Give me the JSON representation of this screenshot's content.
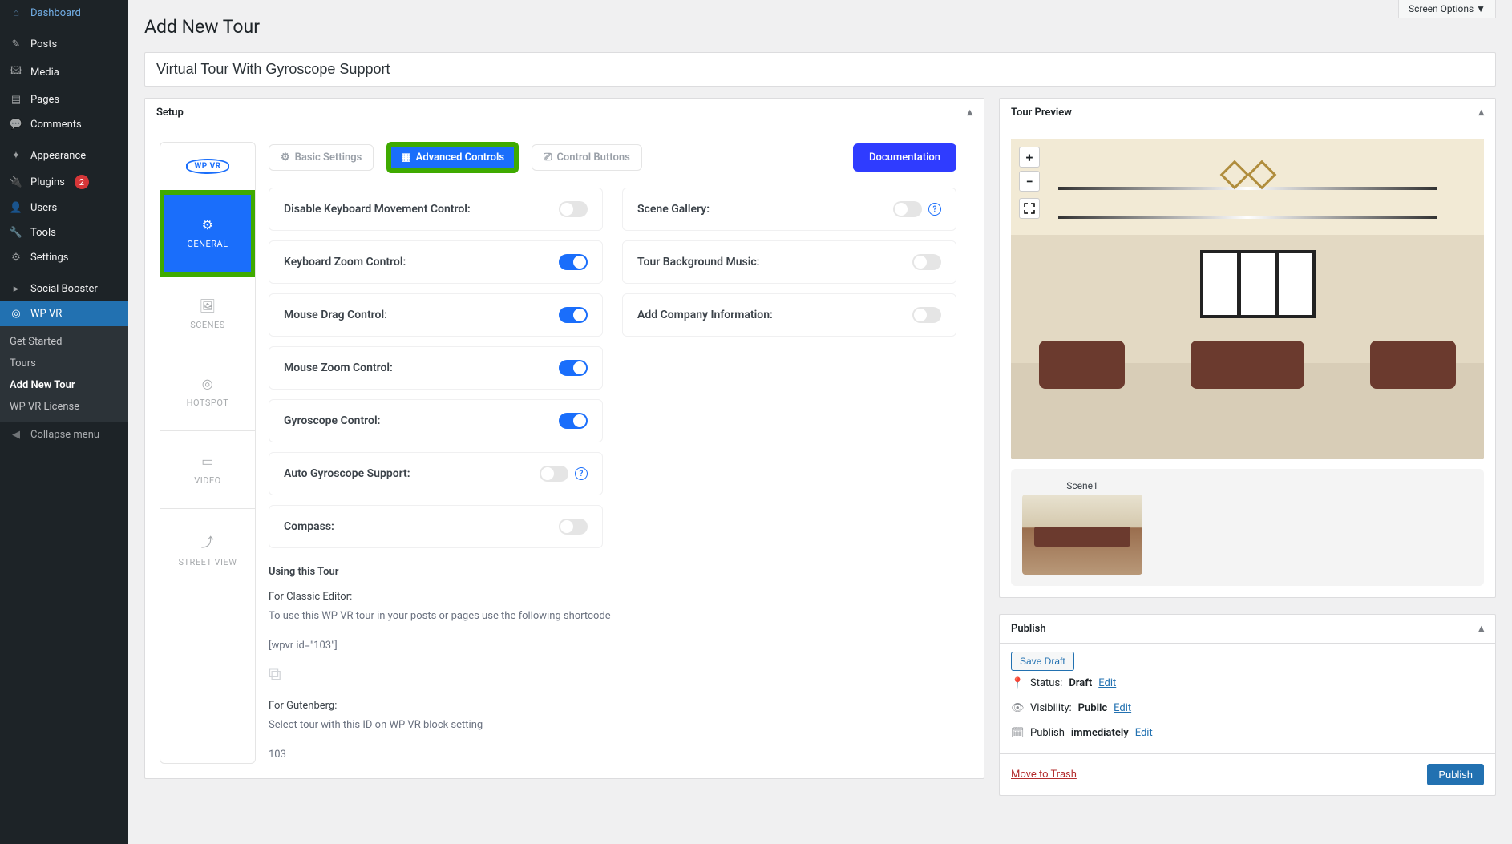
{
  "screen_options": "Screen Options ▼",
  "page_heading": "Add New Tour",
  "title_value": "Virtual Tour With Gyroscope Support",
  "sidebar": {
    "items": [
      {
        "icon": "⌂",
        "label": "Dashboard"
      },
      {
        "icon": "✎",
        "label": "Posts"
      },
      {
        "icon": "🖾",
        "label": "Media"
      },
      {
        "icon": "▤",
        "label": "Pages"
      },
      {
        "icon": "💬",
        "label": "Comments"
      },
      {
        "icon": "✦",
        "label": "Appearance"
      },
      {
        "icon": "🔌",
        "label": "Plugins",
        "badge": "2"
      },
      {
        "icon": "👤",
        "label": "Users"
      },
      {
        "icon": "🔧",
        "label": "Tools"
      },
      {
        "icon": "⚙",
        "label": "Settings"
      },
      {
        "icon": "▸",
        "label": "Social Booster"
      },
      {
        "icon": "◎",
        "label": "WP VR",
        "active": true
      }
    ],
    "submenu": [
      "Get Started",
      "Tours",
      "Add New Tour",
      "WP VR License"
    ],
    "collapse": "Collapse menu"
  },
  "setup": {
    "header": "Setup",
    "vtabs": {
      "logo": "WP VR",
      "general": "GENERAL",
      "scenes": "SCENES",
      "hotspot": "HOTSPOT",
      "video": "VIDEO",
      "street": "STREET VIEW"
    },
    "topTabs": {
      "basic": "Basic Settings",
      "advanced": "Advanced Controls",
      "control_btns": "Control Buttons"
    },
    "doc_btn": "Documentation",
    "controls": {
      "disable_kb": "Disable Keyboard Movement Control:",
      "kb_zoom": "Keyboard Zoom Control:",
      "mouse_drag": "Mouse Drag Control:",
      "mouse_zoom": "Mouse Zoom Control:",
      "gyro": "Gyroscope Control:",
      "auto_gyro": "Auto Gyroscope Support:",
      "compass": "Compass:",
      "scene_gallery": "Scene Gallery:",
      "bg_music": "Tour Background Music:",
      "company": "Add Company Information:"
    },
    "usage": {
      "heading": "Using this Tour",
      "classic_title": "For Classic Editor:",
      "classic_text": "To use this WP VR tour in your posts or pages use the following shortcode",
      "shortcode": "[wpvr id=\"103\"]",
      "gutenberg_title": "For Gutenberg:",
      "gutenberg_text": "Select tour with this ID on WP VR block setting",
      "id": "103"
    }
  },
  "preview": {
    "header": "Tour Preview",
    "zoom_in": "+",
    "zoom_out": "−",
    "scene1": "Scene1"
  },
  "publish": {
    "header": "Publish",
    "save_draft": "Save Draft",
    "status_label": "Status:",
    "status_value": "Draft",
    "visibility_label": "Visibility:",
    "visibility_value": "Public",
    "publish_label": "Publish",
    "publish_value": "immediately",
    "edit": "Edit",
    "trash": "Move to Trash",
    "publish_btn": "Publish"
  }
}
